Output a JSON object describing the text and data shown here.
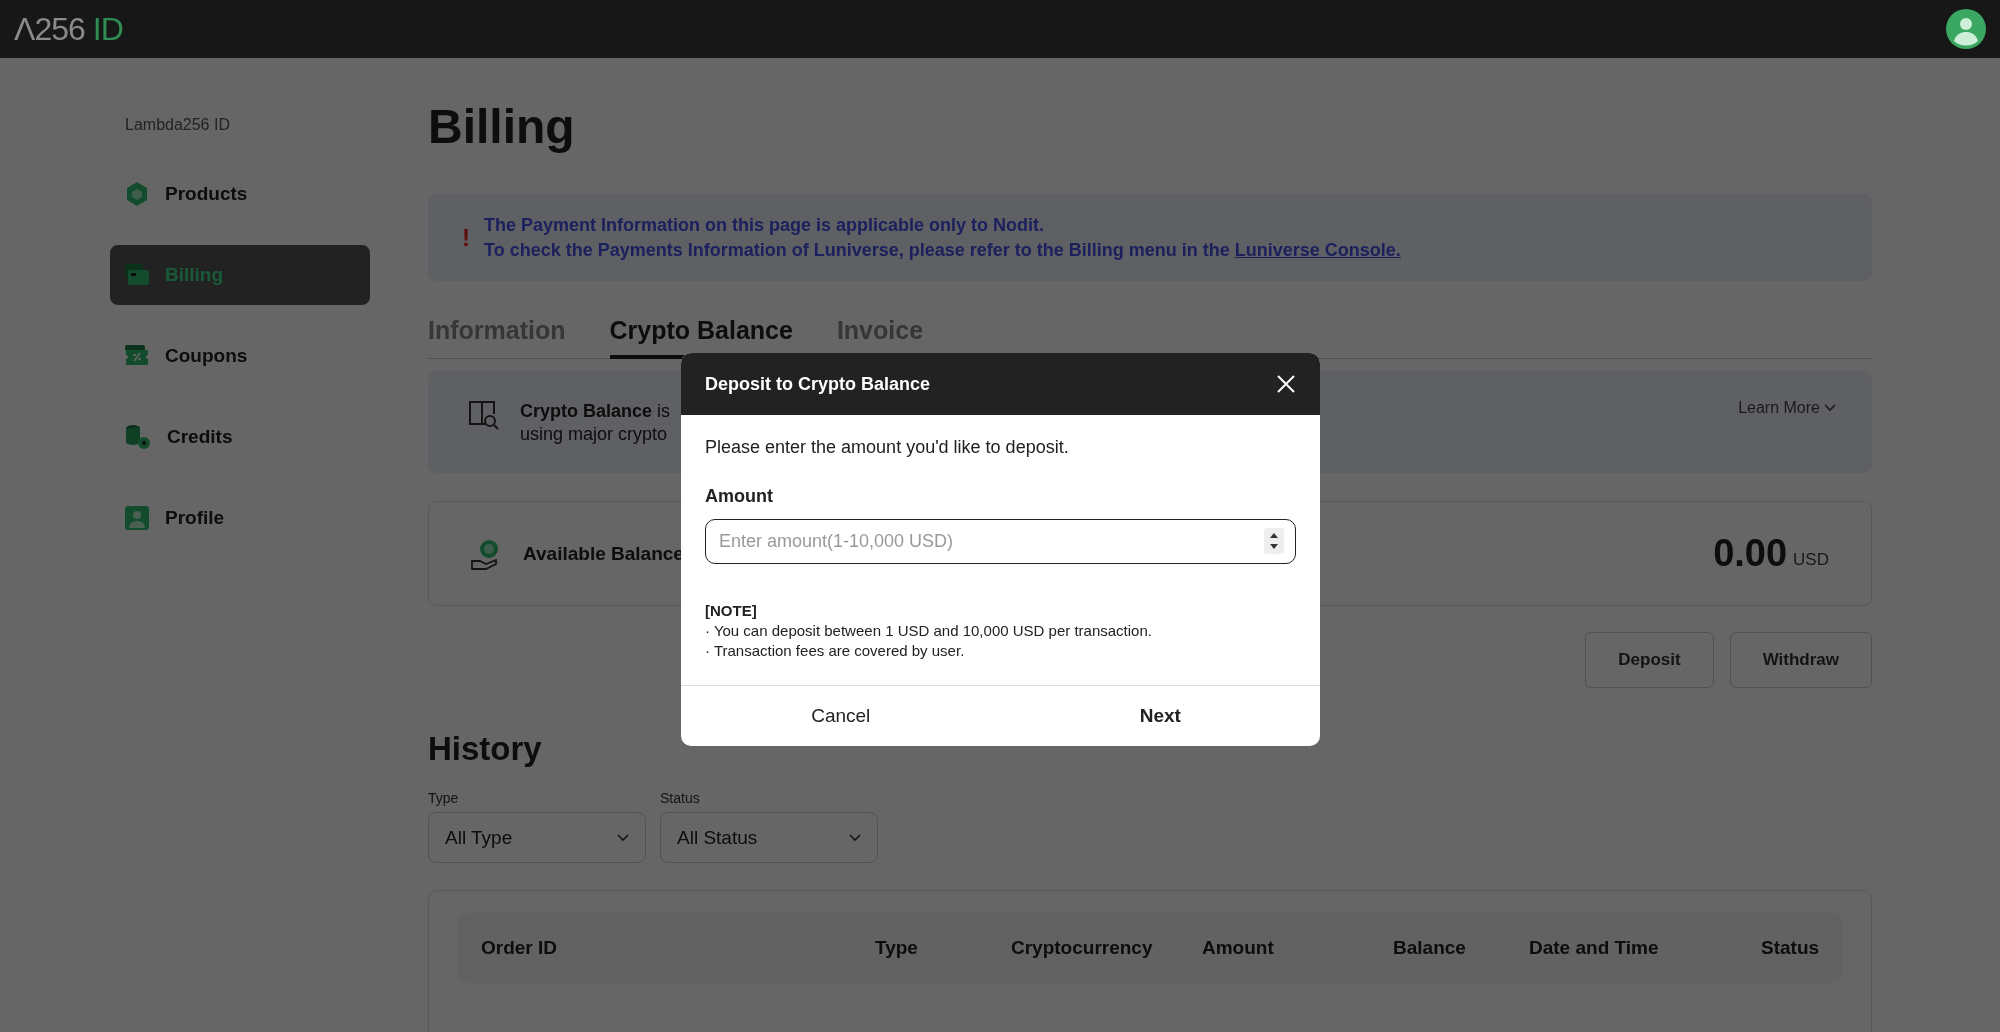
{
  "header": {
    "logo_mark": "Λ256",
    "logo_suffix": "ID"
  },
  "sidebar": {
    "title": "Lambda256 ID",
    "items": [
      {
        "label": "Products",
        "kind": "cube",
        "selected": false
      },
      {
        "label": "Billing",
        "kind": "card",
        "selected": true
      },
      {
        "label": "Coupons",
        "kind": "coupon",
        "selected": false
      },
      {
        "label": "Credits",
        "kind": "coins",
        "selected": false
      },
      {
        "label": "Profile",
        "kind": "person",
        "selected": false
      }
    ]
  },
  "page": {
    "title": "Billing"
  },
  "notice": {
    "mark": "!",
    "line_1": "The Payment Information on this page is applicable only to Nodit.",
    "line_2": "To check the Payments Information of Luniverse, please refer to the Billing menu in the",
    "link": "Luniverse Console."
  },
  "tabs": [
    {
      "label": "Information",
      "selected": false
    },
    {
      "label": "Crypto Balance",
      "selected": true
    },
    {
      "label": "Invoice",
      "selected": false
    }
  ],
  "info_card": {
    "line_1": "**Crypto Balance** is",
    "line_2": "using major crypto",
    "learn_more": "Learn More"
  },
  "balance_card": {
    "label": "Available Balance",
    "amount": "0.00",
    "currency": "USD"
  },
  "actions": [
    "Deposit",
    "Withdraw"
  ],
  "history": {
    "title": "History",
    "filters": [
      {
        "label": "Type",
        "value": "All Type"
      },
      {
        "label": "Status",
        "value": "All Status"
      }
    ],
    "columns": [
      "Order ID",
      "Type",
      "Cryptocurrency",
      "Amount",
      "Balance",
      "Date and Time",
      "Status"
    ]
  },
  "modal": {
    "title": "Deposit to Crypto Balance",
    "prompt": "Please enter the amount you'd like to deposit.",
    "field_label": "Amount",
    "placeholder": "Enter amount(1-10,000 USD)",
    "note_title": "[NOTE]",
    "notes": [
      "· You can deposit between 1 USD and 10,000 USD per transaction.",
      "· Transaction fees are covered by user."
    ],
    "buttons": [
      {
        "label": "Cancel",
        "primary": false
      },
      {
        "label": "Next",
        "primary": true
      }
    ]
  }
}
